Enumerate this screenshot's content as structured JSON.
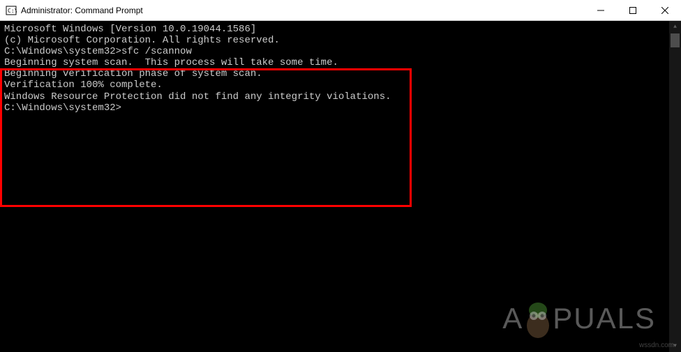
{
  "titlebar": {
    "title": "Administrator: Command Prompt"
  },
  "terminal": {
    "lines": [
      "Microsoft Windows [Version 10.0.19044.1586]",
      "(c) Microsoft Corporation. All rights reserved.",
      "",
      "C:\\Windows\\system32>sfc /scannow",
      "",
      "Beginning system scan.  This process will take some time.",
      "",
      "Beginning verification phase of system scan.",
      "Verification 100% complete.",
      "",
      "Windows Resource Protection did not find any integrity violations.",
      "",
      "C:\\Windows\\system32>"
    ]
  },
  "watermark": {
    "text_before": "A",
    "text_after": "PUALS",
    "small": "wssdn.com"
  }
}
